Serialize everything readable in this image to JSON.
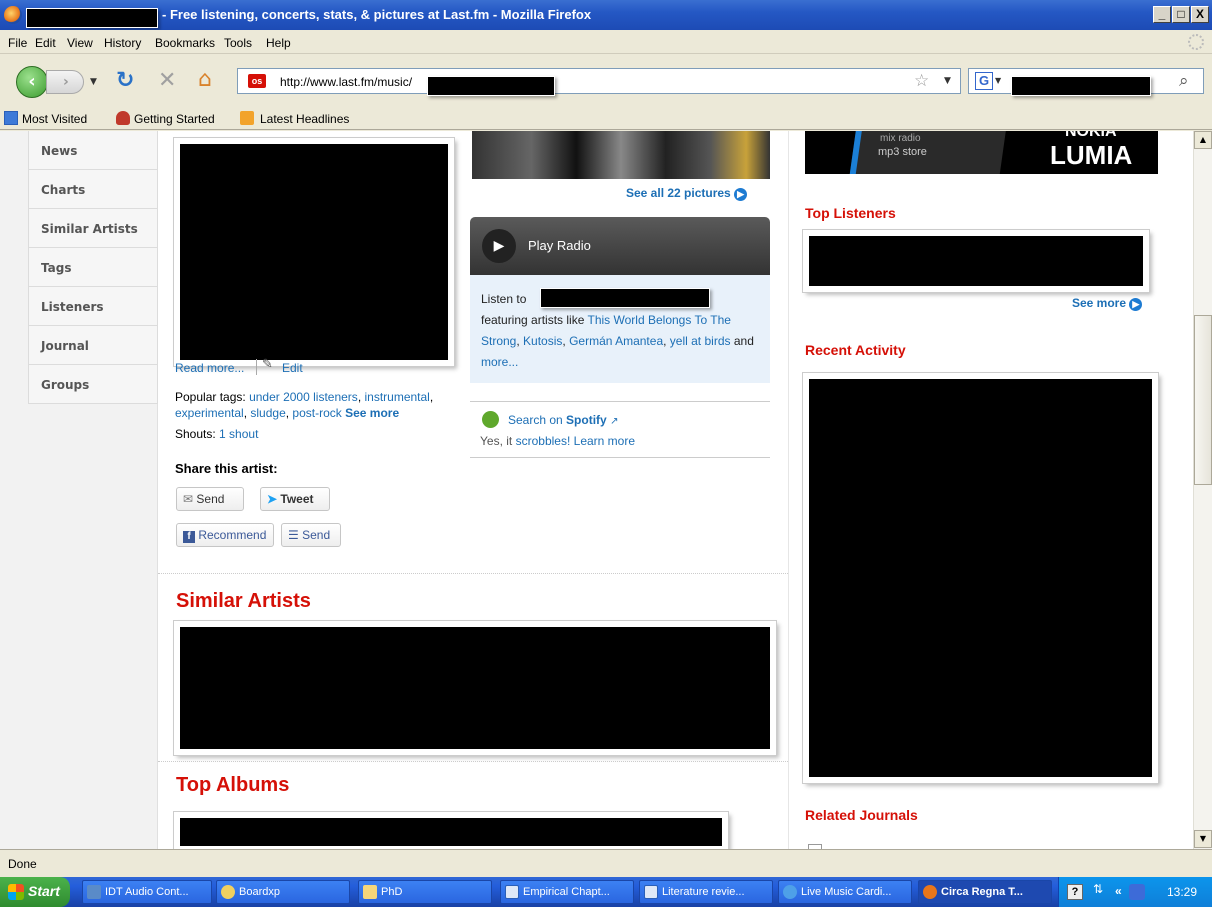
{
  "window": {
    "title": "- Free listening, concerts, stats, & pictures at Last.fm - Mozilla Firefox",
    "min": "_",
    "max": "□",
    "close": "X"
  },
  "menu": [
    "File",
    "Edit",
    "View",
    "History",
    "Bookmarks",
    "Tools",
    "Help"
  ],
  "nav": {
    "url": "http://www.last.fm/music/",
    "search_engine": "G"
  },
  "bookmarks": [
    "Most Visited",
    "Getting Started",
    "Latest Headlines"
  ],
  "sidebar": [
    "News",
    "Charts",
    "Similar Artists",
    "Tags",
    "Listeners",
    "Journal",
    "Groups"
  ],
  "artist": {
    "read_more": "Read more...",
    "edit": "Edit",
    "popular_tags_label": "Popular tags:",
    "tags": [
      "under 2000 listeners",
      "instrumental",
      "experimental",
      "sludge",
      "post-rock"
    ],
    "see_more": "See more",
    "shouts_label": "Shouts:",
    "shouts_link": "1 shout",
    "share_heading": "Share this artist:",
    "share_send": "Send",
    "share_tweet": "Tweet",
    "fb_recommend": "Recommend",
    "fb_send": "Send"
  },
  "pictures": {
    "see_all": "See all 22 pictures"
  },
  "radio": {
    "play_label": "Play Radio",
    "listen_prefix": "Listen to",
    "featuring": "featuring artists like",
    "artist1": "This World Belongs To The Strong",
    "artist2": "Kutosis",
    "artist3": "Germán Amantea",
    "artist4": "yell at birds",
    "and": "and",
    "more": "more..."
  },
  "spotify": {
    "search_prefix": "Search on",
    "spotify": "Spotify",
    "scrobbles_prefix": "Yes, it",
    "scrobbles": "scrobbles!",
    "learn_more": "Learn more"
  },
  "sections": {
    "similar_artists": "Similar Artists",
    "top_albums": "Top Albums",
    "top_listeners": "Top Listeners",
    "recent_activity": "Recent Activity",
    "related_journals": "Related Journals",
    "see_more": "See more"
  },
  "ad": {
    "line1": "mix radio",
    "line2": "mp3 store",
    "brand": "LUMIA",
    "brand_top": "NOKIA"
  },
  "status": "Done",
  "taskbar": {
    "start": "Start",
    "items": [
      "IDT Audio Cont...",
      "Boardxp",
      "PhD",
      "Empirical Chapt...",
      "Literature revie...",
      "Live Music Cardi...",
      "Circa Regna T..."
    ],
    "clock": "13:29",
    "chevron": "«"
  },
  "colors": {
    "lastfm_red": "#d51007",
    "link_blue": "#1d6fb5",
    "xp_blue": "#245edb"
  }
}
